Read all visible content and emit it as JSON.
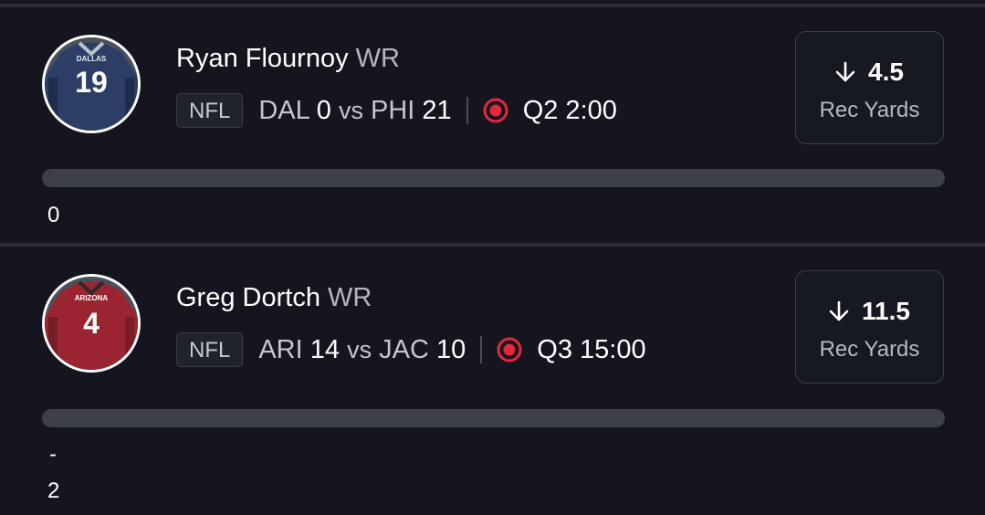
{
  "cards": [
    {
      "player_name": "Ryan Flournoy",
      "position": "WR",
      "league": "NFL",
      "away_team": "DAL",
      "away_score": "0",
      "vs": "vs",
      "home_team": "PHI",
      "home_score": "21",
      "game_clock": "Q2 2:00",
      "line_value": "4.5",
      "stat_label": "Rec Yards",
      "direction_icon": "arrow-down-icon",
      "current_value": "0",
      "progress_fraction": 0,
      "jersey": {
        "team_text": "DALLAS",
        "number": "19",
        "color": "#2c3e66"
      }
    },
    {
      "player_name": "Greg Dortch",
      "position": "WR",
      "league": "NFL",
      "away_team": "ARI",
      "away_score": "14",
      "vs": "vs",
      "home_team": "JAC",
      "home_score": "10",
      "game_clock": "Q3 15:00",
      "line_value": "11.5",
      "stat_label": "Rec Yards",
      "direction_icon": "arrow-down-icon",
      "current_value_sign": "-",
      "current_value": "2",
      "progress_fraction": 0,
      "jersey": {
        "team_text": "ARIZONA",
        "number": "4",
        "color": "#9a2530"
      }
    }
  ],
  "colors": {
    "background": "#14151e",
    "live_indicator": "#e2283c",
    "progress_track": "#3d3f4a"
  }
}
